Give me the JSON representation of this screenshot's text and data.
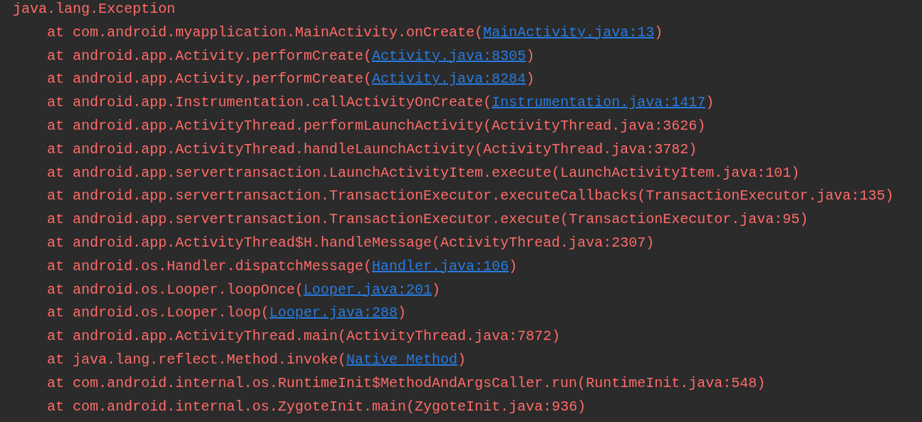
{
  "exception": "java.lang.Exception",
  "frames": [
    {
      "prefix": "at com.android.myapplication.MainActivity.onCreate(",
      "location": "MainActivity.java:13",
      "linked": true,
      "suffix": ")"
    },
    {
      "prefix": "at android.app.Activity.performCreate(",
      "location": "Activity.java:8305",
      "linked": true,
      "suffix": ")"
    },
    {
      "prefix": "at android.app.Activity.performCreate(",
      "location": "Activity.java:8284",
      "linked": true,
      "suffix": ")"
    },
    {
      "prefix": "at android.app.Instrumentation.callActivityOnCreate(",
      "location": "Instrumentation.java:1417",
      "linked": true,
      "suffix": ")"
    },
    {
      "prefix": "at android.app.ActivityThread.performLaunchActivity(",
      "location": "ActivityThread.java:3626",
      "linked": false,
      "suffix": ")"
    },
    {
      "prefix": "at android.app.ActivityThread.handleLaunchActivity(",
      "location": "ActivityThread.java:3782",
      "linked": false,
      "suffix": ")"
    },
    {
      "prefix": "at android.app.servertransaction.LaunchActivityItem.execute(",
      "location": "LaunchActivityItem.java:101",
      "linked": false,
      "suffix": ")"
    },
    {
      "prefix": "at android.app.servertransaction.TransactionExecutor.executeCallbacks(",
      "location": "TransactionExecutor.java:135",
      "linked": false,
      "suffix": ")"
    },
    {
      "prefix": "at android.app.servertransaction.TransactionExecutor.execute(",
      "location": "TransactionExecutor.java:95",
      "linked": false,
      "suffix": ")"
    },
    {
      "prefix": "at android.app.ActivityThread$H.handleMessage(",
      "location": "ActivityThread.java:2307",
      "linked": false,
      "suffix": ")"
    },
    {
      "prefix": "at android.os.Handler.dispatchMessage(",
      "location": "Handler.java:106",
      "linked": true,
      "suffix": ")"
    },
    {
      "prefix": "at android.os.Looper.loopOnce(",
      "location": "Looper.java:201",
      "linked": true,
      "suffix": ")"
    },
    {
      "prefix": "at android.os.Looper.loop(",
      "location": "Looper.java:288",
      "linked": true,
      "suffix": ")"
    },
    {
      "prefix": "at android.app.ActivityThread.main(",
      "location": "ActivityThread.java:7872",
      "linked": false,
      "suffix": ")"
    },
    {
      "prefix": "at java.lang.reflect.Method.invoke(",
      "location": "Native Method",
      "linked": true,
      "suffix": ")"
    },
    {
      "prefix": "at com.android.internal.os.RuntimeInit$MethodAndArgsCaller.run(",
      "location": "RuntimeInit.java:548",
      "linked": false,
      "suffix": ")"
    },
    {
      "prefix": "at com.android.internal.os.ZygoteInit.main(",
      "location": "ZygoteInit.java:936",
      "linked": false,
      "suffix": ")"
    }
  ]
}
